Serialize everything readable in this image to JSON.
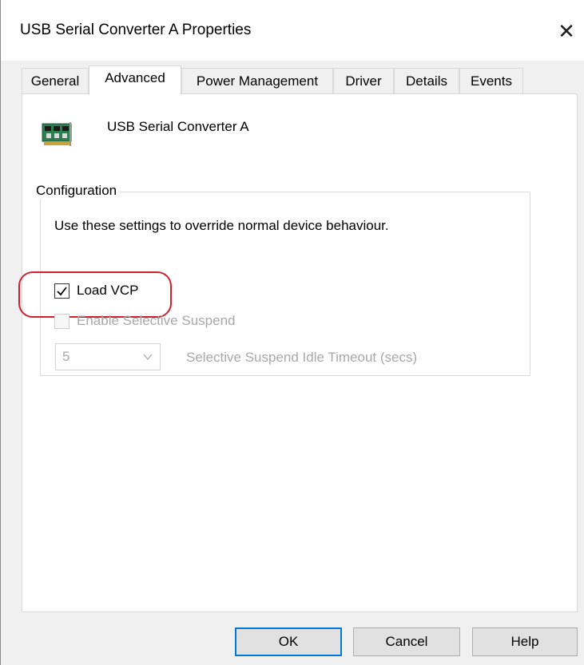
{
  "window": {
    "title": "USB Serial Converter A Properties"
  },
  "tabs": [
    "General",
    "Advanced",
    "Power Management",
    "Driver",
    "Details",
    "Events"
  ],
  "active_tab": "Advanced",
  "device": {
    "name": "USB Serial Converter A",
    "icon": "circuit-board-icon"
  },
  "configuration": {
    "group_title": "Configuration",
    "description": "Use these settings to override normal device behaviour.",
    "load_vcp": {
      "label": "Load VCP",
      "checked": true,
      "enabled": true
    },
    "selective_suspend": {
      "label": "Enable Selective Suspend",
      "checked": false,
      "enabled": false
    },
    "idle_timeout": {
      "value": "5",
      "label": "Selective Suspend Idle Timeout (secs)",
      "enabled": false
    }
  },
  "buttons": {
    "ok": "OK",
    "cancel": "Cancel",
    "help": "Help"
  },
  "colors": {
    "highlight_ring": "#d0202e",
    "default_button_border": "#0078d7"
  }
}
